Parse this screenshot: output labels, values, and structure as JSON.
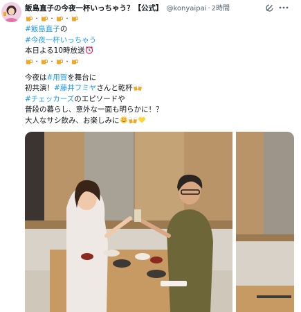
{
  "account": {
    "display_name": "飯島直子の今夜一杯いっちゃう？【公式】",
    "handle": "@konyaipai",
    "separator": "·",
    "time": "2時間"
  },
  "tweet": {
    "line1_suffix": "の",
    "hashtag_name": "#飯島直子",
    "hashtag_show": "#今夜一杯いっちゃう",
    "broadcast": "本日よる10時放送",
    "tonight_prefix": "今夜は",
    "hashtag_place": "#用賀",
    "tonight_suffix": "を舞台に",
    "debut_prefix": "初共演！",
    "hashtag_guest": "#藤井フミヤ",
    "debut_suffix": "さんと乾杯",
    "hashtag_band": "#チェッカーズ",
    "episode_suffix": "のエピソードや",
    "daily_life": "普段の暮らし、意外な一面も明らかに！？",
    "closing": "大人なサシ飲み、お楽しみに"
  },
  "icons": [
    "grok-icon",
    "more-icon",
    "beer-icon",
    "clock-icon",
    "cheers-icon",
    "smile-icon",
    "heart-icon"
  ],
  "colors": {
    "link": "#1d9bf0",
    "muted": "#536471",
    "beer": "#f3a823"
  },
  "media": {
    "photo_count": 2
  }
}
